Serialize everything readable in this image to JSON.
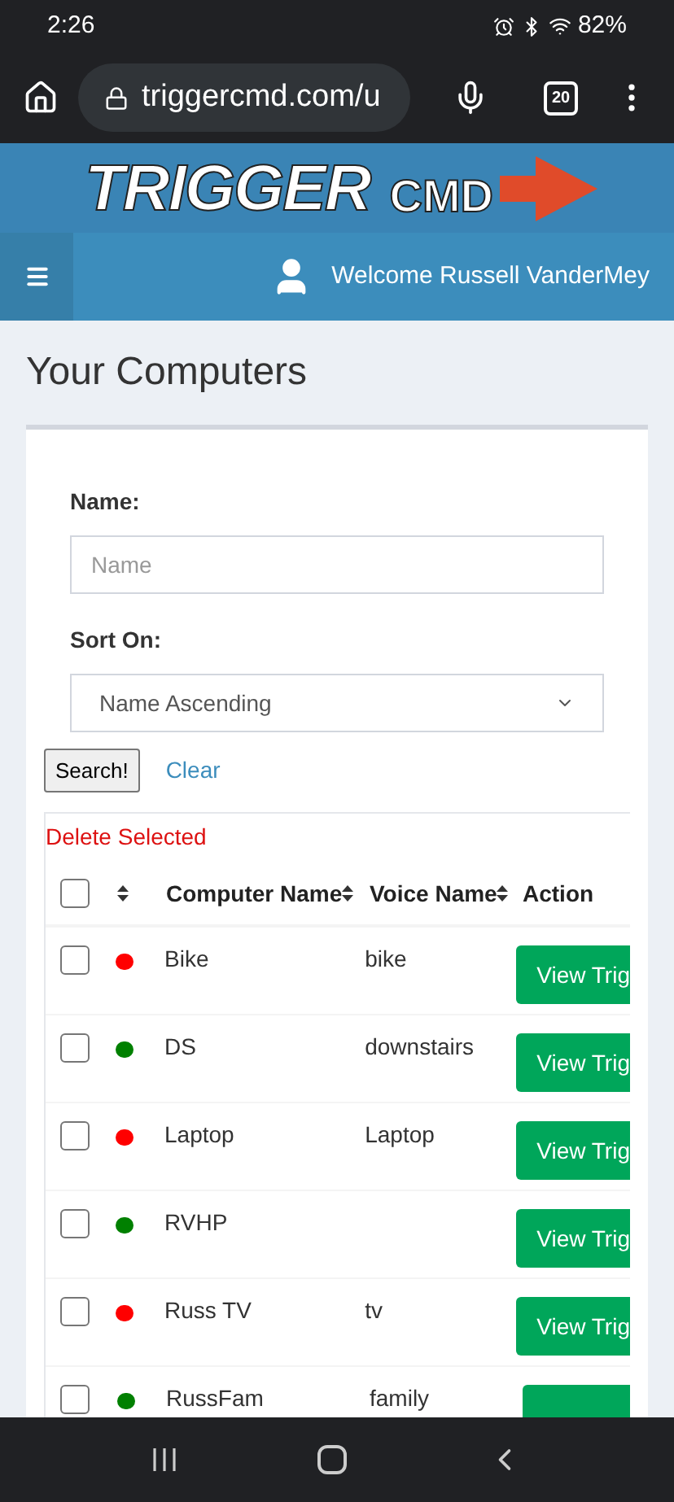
{
  "status_bar": {
    "time": "2:26",
    "battery": "82%"
  },
  "browser": {
    "url": "triggercmd.com/u",
    "tab_count": "20"
  },
  "logo": {
    "word1": "TRIGGER",
    "word2": "CMD"
  },
  "nav": {
    "welcome": "Welcome Russell VanderMey"
  },
  "page_title": "Your Computers",
  "filter": {
    "name_label": "Name:",
    "name_placeholder": "Name",
    "sort_label": "Sort On:",
    "sort_value": "Name Ascending",
    "search_button": "Search!",
    "clear_link": "Clear"
  },
  "delete_selected": "Delete Selected",
  "table": {
    "columns": [
      "Computer Name",
      "Voice Name",
      "Action"
    ],
    "all_checked": false,
    "rows": [
      {
        "checked": false,
        "color": "#ff0000",
        "name": "Bike",
        "voice": "bike",
        "action": "View Trig"
      },
      {
        "checked": false,
        "color": "#008000",
        "name": "DS",
        "voice": "downstairs",
        "action": "View Trig"
      },
      {
        "checked": false,
        "color": "#ff0000",
        "name": "Laptop",
        "voice": "Laptop",
        "action": "View Trig"
      },
      {
        "checked": false,
        "color": "#008000",
        "name": "RVHP",
        "voice": "",
        "action": "View Trig"
      },
      {
        "checked": false,
        "color": "#ff0000",
        "name": "Russ TV",
        "voice": "tv",
        "action": "View Trig"
      },
      {
        "checked": false,
        "color": "#008000",
        "name": "RussFam",
        "voice": "family"
      }
    ]
  }
}
